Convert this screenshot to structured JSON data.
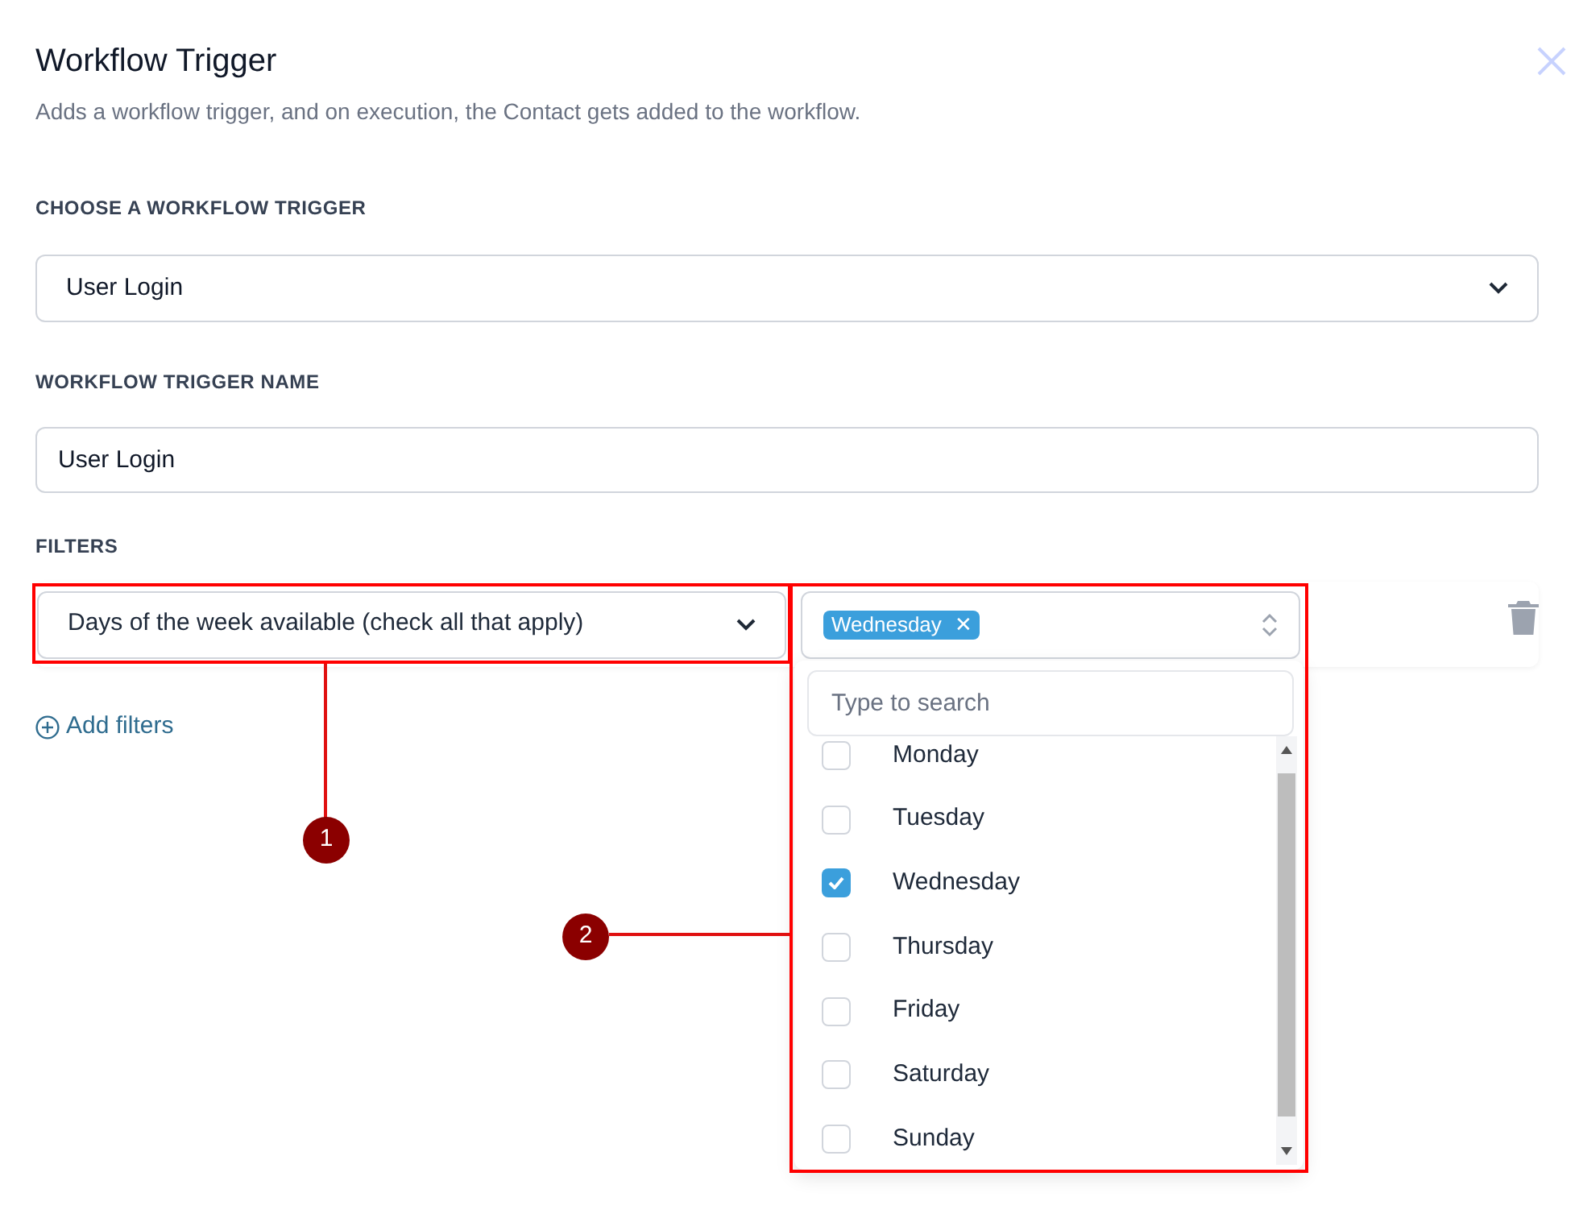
{
  "dialog": {
    "title": "Workflow Trigger",
    "subtitle": "Adds a workflow trigger, and on execution, the Contact gets added to the workflow."
  },
  "trigger_select": {
    "label": "CHOOSE A WORKFLOW TRIGGER",
    "value": "User Login"
  },
  "name_field": {
    "label": "WORKFLOW TRIGGER NAME",
    "value": "User Login"
  },
  "filters": {
    "label": "FILTERS",
    "field_select": {
      "value": "Days of the week available (check all that apply)"
    },
    "tags": [
      {
        "label": "Wednesday",
        "remove": "✕"
      }
    ],
    "dropdown": {
      "search": {
        "placeholder": "Type to search"
      },
      "options": [
        {
          "label": "Monday",
          "checked": false
        },
        {
          "label": "Tuesday",
          "checked": false
        },
        {
          "label": "Wednesday",
          "checked": true
        },
        {
          "label": "Thursday",
          "checked": false
        },
        {
          "label": "Friday",
          "checked": false
        },
        {
          "label": "Saturday",
          "checked": false
        },
        {
          "label": "Sunday",
          "checked": false
        }
      ]
    },
    "add_link": "Add filters"
  },
  "annotations": [
    {
      "label": "1"
    },
    {
      "label": "2"
    }
  ]
}
